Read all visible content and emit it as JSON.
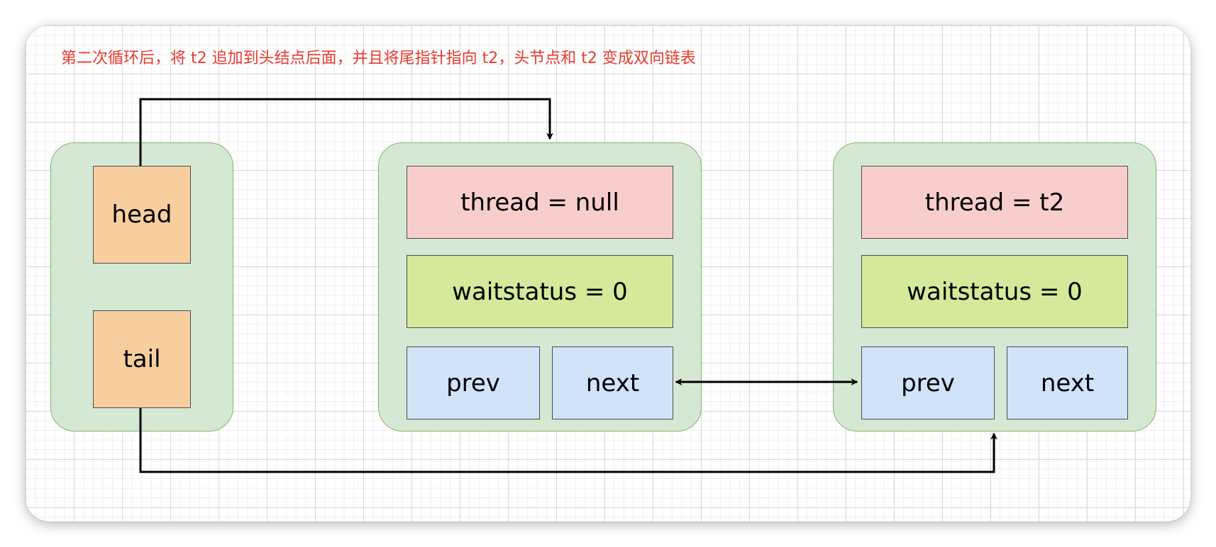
{
  "caption": {
    "text": "第二次循环后，将 t2 追加到头结点后面，并且将尾指针指向 t2，头节点和 t2 变成双向链表",
    "color": "#e83a2f"
  },
  "pointers": {
    "head_label": "head",
    "tail_label": "tail"
  },
  "node1": {
    "thread": "thread = null",
    "waitstatus": "waitstatus = 0",
    "prev": "prev",
    "next": "next"
  },
  "node2": {
    "thread": "thread = t2",
    "waitstatus": "waitstatus = 0",
    "prev": "prev",
    "next": "next"
  },
  "colors": {
    "group_fill": "#d5e8d4",
    "group_stroke": "#82b366",
    "pointer_fill": "#f8ce9f",
    "thread_fill": "#f8cecc",
    "waitstatus_fill": "#d4e99a",
    "link_fill": "#d0e3f9",
    "arrow": "#000000"
  }
}
